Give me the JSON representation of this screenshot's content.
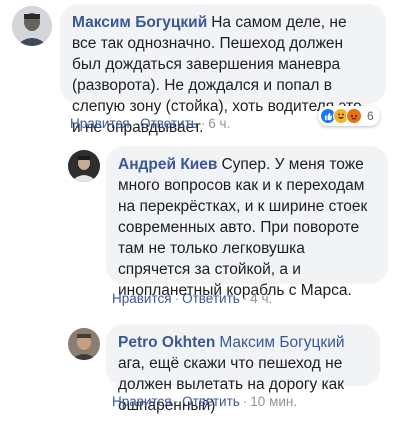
{
  "comments": [
    {
      "author": "Максим Богуцкий",
      "text": "На самом деле, не все так однозначно. Пешеход должен был дождаться завершения маневра (разворота). Не дождался и попал в слепую зону (стойка), хоть водителя это и не оправдывает.",
      "like": "Нравится",
      "reply": "Ответить",
      "time": "6 ч.",
      "reaction_count": "6",
      "reactions": [
        "like-icon",
        "haha-icon",
        "angry-icon"
      ]
    },
    {
      "author": "Андрей Киев",
      "text": "Супер. У меня тоже много вопросов как и к переходам на перекрёстках, и к ширине стоек современных авто. При повороте там не только легковушка спрячется за стойкой, а и инопланетный корабль с Марса.",
      "like": "Нравится",
      "reply": "Ответить",
      "time": "4 ч."
    },
    {
      "author": "Petro Okhten",
      "mention": "Максим Богуцкий",
      "text": "ага, ещё скажи что пешеход не должен вылетать на дорогу как ошпаренный)",
      "like": "Нравится",
      "reply": "Ответить",
      "time": "10 мин."
    }
  ],
  "separator": "·",
  "colors": {
    "link": "#385898",
    "bubble": "#f2f3f5",
    "meta": "#90949c"
  }
}
